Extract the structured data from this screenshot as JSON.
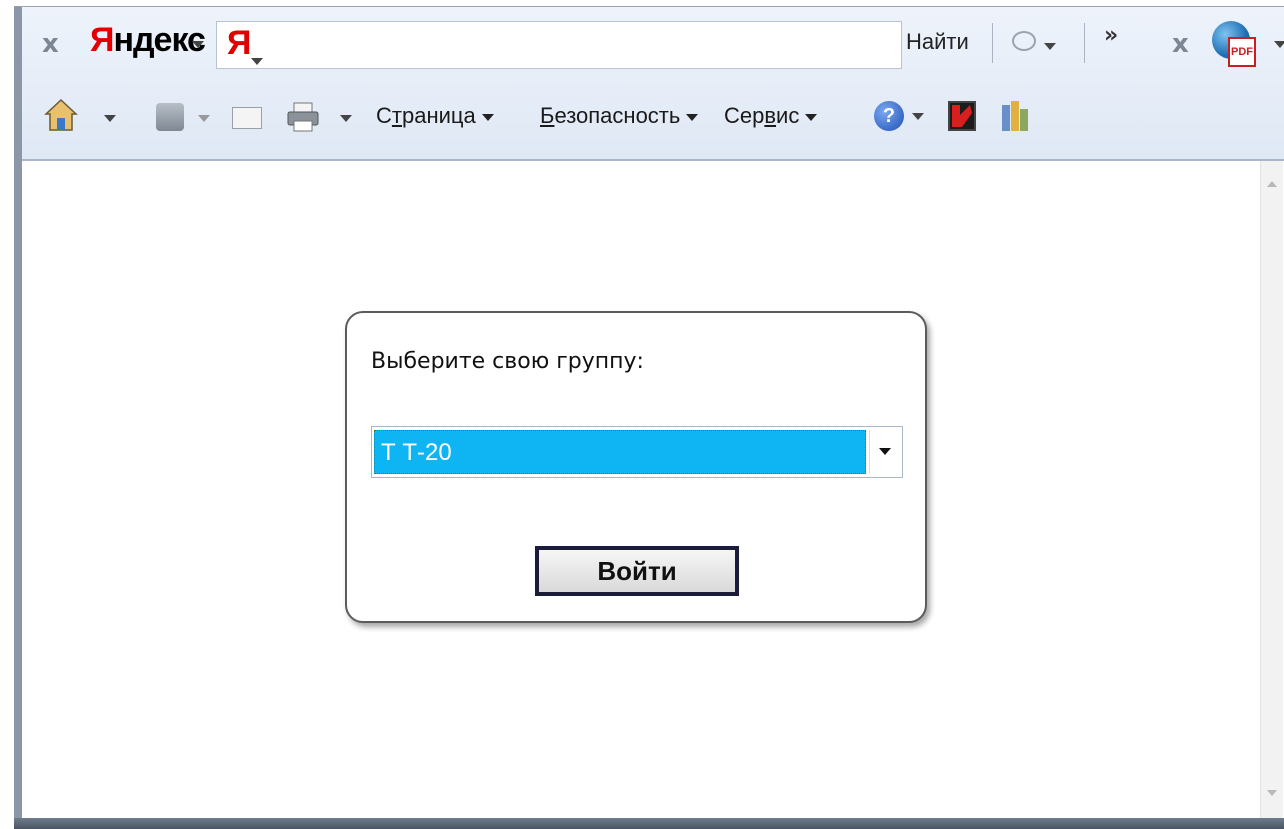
{
  "yandex_bar": {
    "brand": "Яндекс",
    "brand_first_letter": "Я",
    "brand_rest": "ндекс",
    "search_logo_letter": "Я",
    "search_value": "",
    "find_label": "Найти",
    "more_label": "»",
    "close_label": "x"
  },
  "command_bar": {
    "page_label_pre": "С",
    "page_label_u": "т",
    "page_label_post": "раница",
    "security_label_u": "Б",
    "security_label_post": "езопасность",
    "service_label_pre": "Сер",
    "service_label_u": "в",
    "service_label_post": "ис",
    "help_glyph": "?"
  },
  "login_panel": {
    "prompt": "Выберите свою группу:",
    "selected_group": "Т Т-20",
    "submit_label": "Войти"
  },
  "colors": {
    "selection": "#0fb4f3",
    "yandex_red": "#e00000",
    "toolbar_bg": "#e6edf7"
  }
}
